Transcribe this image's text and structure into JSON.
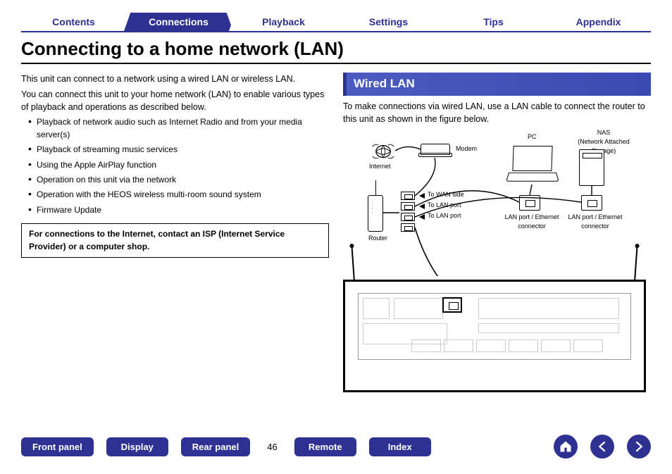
{
  "tabs": {
    "contents": "Contents",
    "connections": "Connections",
    "playback": "Playback",
    "settings": "Settings",
    "tips": "Tips",
    "appendix": "Appendix"
  },
  "title": "Connecting to a home network (LAN)",
  "left": {
    "p1": "This unit can connect to a network using a wired LAN or wireless LAN.",
    "p2": "You can connect this unit to your home network (LAN) to enable various types of playback and operations as described below.",
    "bullets": [
      "Playback of network audio such as Internet Radio and from your media server(s)",
      "Playback of streaming music services",
      "Using the Apple AirPlay function",
      "Operation on this unit via the network",
      "Operation with the HEOS wireless multi-room sound system",
      "Firmware Update"
    ],
    "note": "For connections to the Internet, contact an ISP (Internet Service Provider) or a computer shop."
  },
  "right": {
    "heading": "Wired LAN",
    "intro": "To make connections via wired LAN, use a LAN cable to connect the router to this unit as shown in the figure below.",
    "labels": {
      "internet": "Internet",
      "modem": "Modem",
      "router": "Router",
      "pc": "PC",
      "nas": "NAS\n(Network Attached Storage)",
      "to_wan": "To WAN side",
      "to_lan1": "To LAN port",
      "to_lan2": "To LAN port",
      "lan_eth1": "LAN port / Ethernet\nconnector",
      "lan_eth2": "LAN port / Ethernet\nconnector"
    }
  },
  "bottom": {
    "front": "Front panel",
    "display": "Display",
    "rear": "Rear panel",
    "remote": "Remote",
    "index": "Index",
    "page": "46"
  }
}
